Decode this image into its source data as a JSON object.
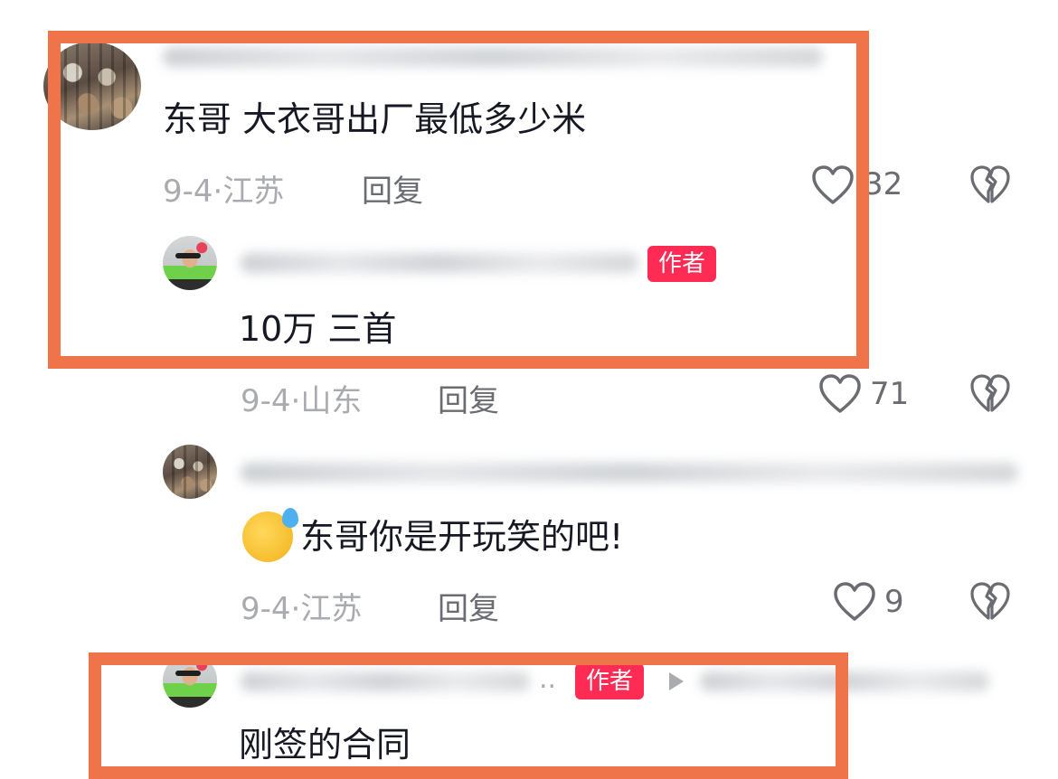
{
  "comments": [
    {
      "text": "东哥  大衣哥出厂最低多少米",
      "date": "9-4·",
      "location": "江苏",
      "reply_label": "回复",
      "likes": "32"
    },
    {
      "badge": "作者",
      "text": "10万 三首",
      "date": "9-4·",
      "location": "山东",
      "reply_label": "回复",
      "likes": "71"
    },
    {
      "text": "东哥你是开玩笑的吧!",
      "date": "9-4·",
      "location": "江苏",
      "reply_label": "回复",
      "likes": "9"
    },
    {
      "badge": "作者",
      "ellipsis": "..",
      "text": "刚签的合同"
    }
  ],
  "icons": {
    "like": "heart-outline-icon",
    "dislike": "broken-heart-icon",
    "reply_arrow": "play-triangle-icon",
    "emoji": "sweat-smile-emoji"
  },
  "colors": {
    "highlight_frame": "#f0744a",
    "author_badge": "#fe2c55"
  }
}
